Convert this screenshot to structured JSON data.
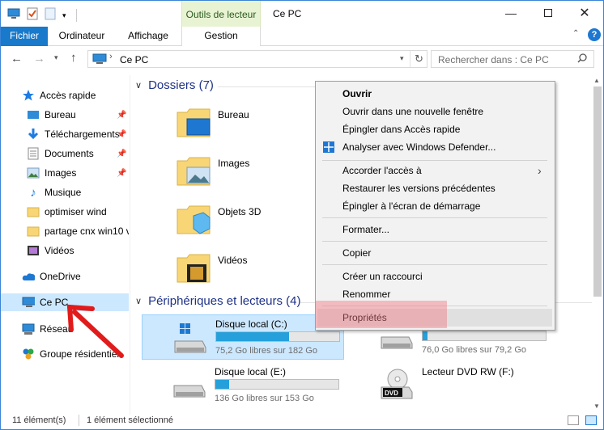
{
  "titlebar": {
    "contextual_tab": "Outils de lecteur",
    "title": "Ce PC",
    "minimize_icon": "minimize-icon",
    "maximize_icon": "maximize-icon",
    "close_icon": "close-icon"
  },
  "ribbon": {
    "tabs": [
      "Fichier",
      "Ordinateur",
      "Affichage",
      "Gestion"
    ],
    "file_color": "#1979ca",
    "context_color": "#e8f3d4"
  },
  "address": {
    "path": "Ce PC",
    "search_placeholder": "Rechercher dans : Ce PC"
  },
  "nav": {
    "quick_access": "Accès rapide",
    "items": [
      "Bureau",
      "Téléchargements",
      "Documents",
      "Images",
      "Musique",
      "optimiser wind",
      "partage cnx win10 v",
      "Vidéos"
    ],
    "onedrive": "OneDrive",
    "this_pc": "Ce PC",
    "network": "Réseau",
    "homegroup": "Groupe résidentiel"
  },
  "content": {
    "folders_header": "Dossiers (7)",
    "folders": [
      "Bureau",
      "Images",
      "Objets 3D",
      "Vidéos"
    ],
    "devices_header": "Périphériques et lecteurs (4)",
    "drives": [
      {
        "name": "Disque local (C:)",
        "free": "75,2 Go libres sur 182 Go",
        "used_fraction": 0.59
      },
      {
        "name": "",
        "free": "76,0 Go libres sur 79,2 Go",
        "used_fraction": 0.04
      },
      {
        "name": "Disque local (E:)",
        "free": "136 Go libres sur 153 Go",
        "used_fraction": 0.11
      },
      {
        "name": "Lecteur DVD RW (F:)",
        "free": "",
        "used_fraction": 0
      }
    ],
    "dvd_label": "DVD"
  },
  "context_menu": {
    "items": [
      "Ouvrir",
      "Ouvrir dans une nouvelle fenêtre",
      "Épingler dans Accès rapide",
      "Analyser avec Windows Defender...",
      "Accorder l'accès à",
      "Restaurer les versions précédentes",
      "Épingler à l'écran de démarrage",
      "Formater...",
      "Copier",
      "Créer un raccourci",
      "Renommer",
      "Propriétés"
    ],
    "submenu_arrow": "chevron-right-icon",
    "highlight_color": "#f08a92"
  },
  "status": {
    "count": "11 élément(s)",
    "selected": "1 élément sélectionné"
  },
  "annotation": {
    "arrow_color": "#e11b1b"
  }
}
